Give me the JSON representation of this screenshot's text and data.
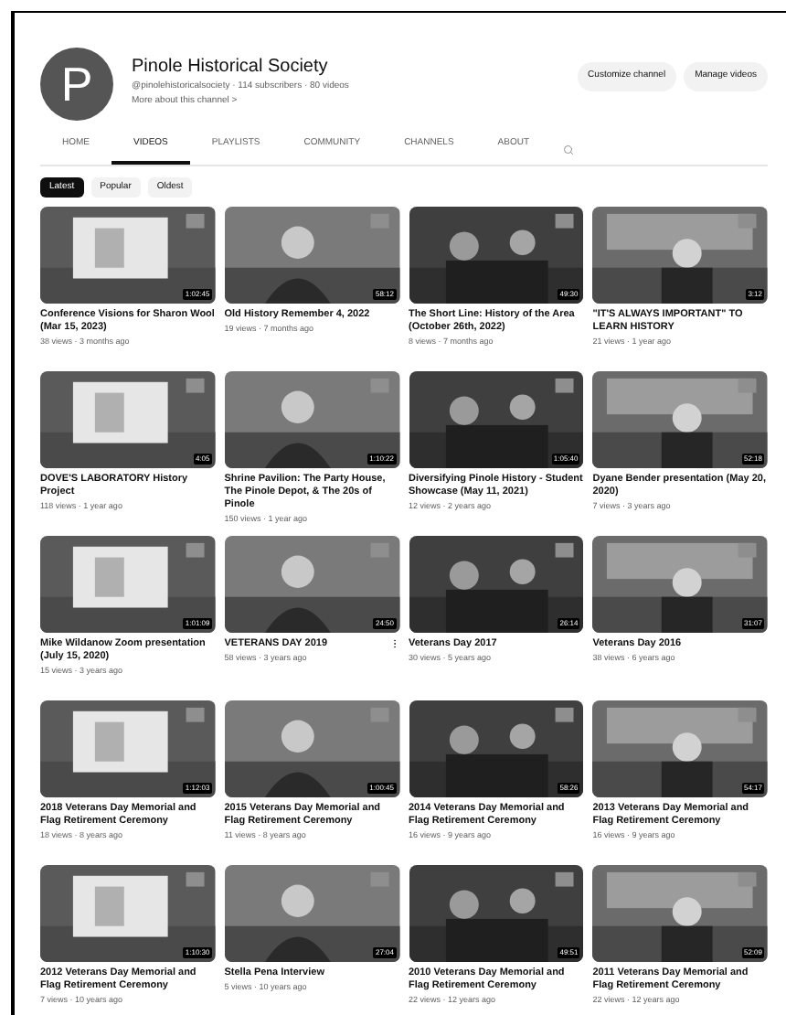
{
  "channel": {
    "avatar_letter": "P",
    "name": "Pinole Historical Society",
    "handle_line": "@pinolehistoricalsociety · 114 subscribers · 80 videos",
    "more_link": "More about this channel >",
    "buttons": [
      "Customize channel",
      "Manage videos"
    ]
  },
  "tabs": [
    {
      "label": "HOME",
      "selected": false
    },
    {
      "label": "VIDEOS",
      "selected": true
    },
    {
      "label": "PLAYLISTS",
      "selected": false
    },
    {
      "label": "COMMUNITY",
      "selected": false
    },
    {
      "label": "CHANNELS",
      "selected": false
    },
    {
      "label": "ABOUT",
      "selected": false
    }
  ],
  "chips": [
    {
      "label": "Latest",
      "selected": true
    },
    {
      "label": "Popular",
      "selected": false
    },
    {
      "label": "Oldest",
      "selected": false
    }
  ],
  "videos": [
    {
      "title": "Conference Visions for Sharon Wool (Mar 15, 2023)",
      "meta": "38 views · 3 months ago",
      "duration": "1:02:45",
      "menu": false
    },
    {
      "title": "Old History Remember 4, 2022",
      "meta": "19 views · 7 months ago",
      "duration": "58:12",
      "menu": false
    },
    {
      "title": "The Short Line: History of the Area (October 26th, 2022)",
      "meta": "8 views · 7 months ago",
      "duration": "49:30",
      "menu": false
    },
    {
      "title": "\"IT'S ALWAYS IMPORTANT\" TO LEARN HISTORY",
      "meta": "21 views · 1 year ago",
      "duration": "3:12",
      "menu": false
    },
    {
      "title": "DOVE'S LABORATORY History Project",
      "meta": "118 views · 1 year ago",
      "duration": "4:05",
      "menu": false
    },
    {
      "title": "Shrine Pavilion: The Party House, The Pinole Depot, & The 20s of Pinole",
      "meta": "150 views · 1 year ago",
      "duration": "1:10:22",
      "menu": false
    },
    {
      "title": "Diversifying Pinole History - Student Showcase (May 11, 2021)",
      "meta": "12 views · 2 years ago",
      "duration": "1:05:40",
      "menu": false
    },
    {
      "title": "Dyane Bender presentation (May 20, 2020)",
      "meta": "7 views · 3 years ago",
      "duration": "52:18",
      "menu": false
    },
    {
      "title": "Mike Wildanow Zoom presentation (July 15, 2020)",
      "meta": "15 views · 3 years ago",
      "duration": "1:01:09",
      "menu": false
    },
    {
      "title": "VETERANS DAY 2019",
      "meta": "58 views · 3 years ago",
      "duration": "24:50",
      "menu": true
    },
    {
      "title": "Veterans Day 2017",
      "meta": "30 views · 5 years ago",
      "duration": "26:14",
      "menu": false
    },
    {
      "title": "Veterans Day 2016",
      "meta": "38 views · 6 years ago",
      "duration": "31:07",
      "menu": false
    },
    {
      "title": "2018 Veterans Day Memorial and Flag Retirement Ceremony",
      "meta": "18 views · 8 years ago",
      "duration": "1:12:03",
      "menu": false
    },
    {
      "title": "2015 Veterans Day Memorial and Flag Retirement Ceremony",
      "meta": "11 views · 8 years ago",
      "duration": "1:00:45",
      "menu": false
    },
    {
      "title": "2014 Veterans Day Memorial and Flag Retirement Ceremony",
      "meta": "16 views · 9 years ago",
      "duration": "58:26",
      "menu": false
    },
    {
      "title": "2013 Veterans Day Memorial and Flag Retirement Ceremony",
      "meta": "16 views · 9 years ago",
      "duration": "54:17",
      "menu": false
    },
    {
      "title": "2012 Veterans Day Memorial and Flag Retirement Ceremony",
      "meta": "7 views · 10 years ago",
      "duration": "1:10:30",
      "menu": false
    },
    {
      "title": "Stella Pena Interview",
      "meta": "5 views · 10 years ago",
      "duration": "27:04",
      "menu": false
    },
    {
      "title": "2010 Veterans Day Memorial and Flag Retirement Ceremony",
      "meta": "22 views · 12 years ago",
      "duration": "49:51",
      "menu": false
    },
    {
      "title": "2011 Veterans Day Memorial and Flag Retirement Ceremony",
      "meta": "22 views · 12 years ago",
      "duration": "52:09",
      "menu": false
    }
  ]
}
